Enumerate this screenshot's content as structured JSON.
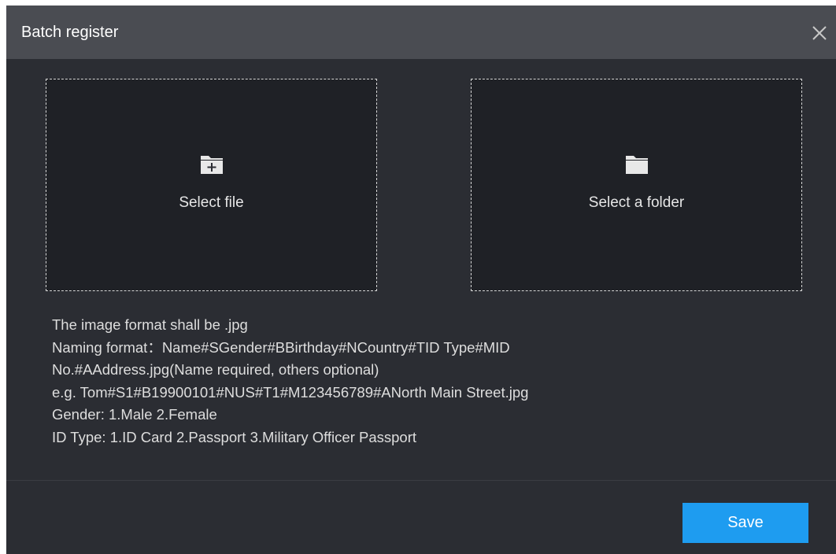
{
  "dialog": {
    "title": "Batch register",
    "close_icon": "close-icon"
  },
  "select_file": {
    "icon": "folder-plus-icon",
    "label": "Select file"
  },
  "select_folder": {
    "icon": "folder-icon",
    "label": "Select a folder"
  },
  "instructions": [
    "The image format shall be  .jpg",
    " Naming format：Name#SGender#BBirthday#NCountry#TID Type#MID",
    "No.#AAddress.jpg(Name required, others optional)",
    "e.g. Tom#S1#B19900101#NUS#T1#M123456789#ANorth Main Street.jpg",
    "Gender: 1.Male 2.Female",
    "ID Type: 1.ID Card 2.Passport 3.Military Officer Passport"
  ],
  "footer": {
    "save_label": "Save"
  },
  "colors": {
    "dialog_bg": "#2b2d33",
    "titlebar_bg": "#4a4c52",
    "dropzone_bg": "#1f2126",
    "accent": "#1e9cf0"
  }
}
